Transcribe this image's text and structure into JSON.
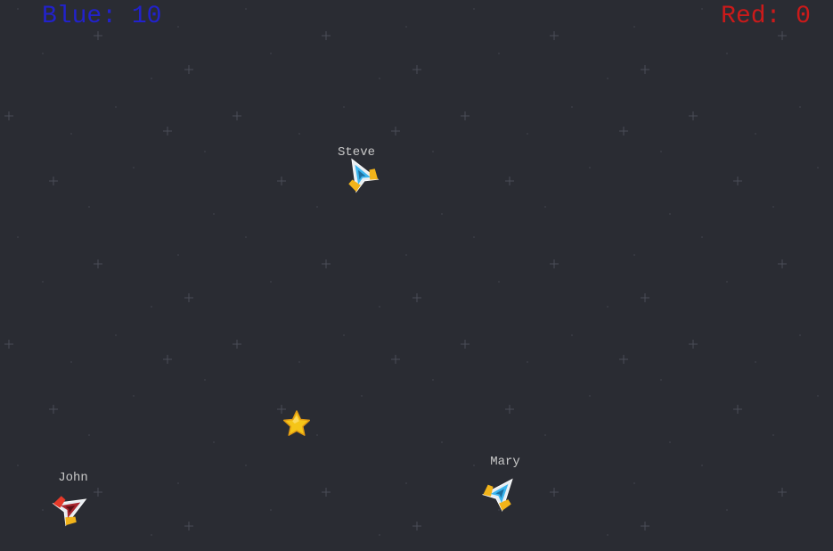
{
  "scoreboard": {
    "blue_label": "Blue: 10",
    "blue_color": "#2222cc",
    "red_label": "Red: 0",
    "red_color": "#cc1a1a"
  },
  "players": {
    "steve": {
      "name": "Steve",
      "team": "blue",
      "icon": "spaceship-icon"
    },
    "mary": {
      "name": "Mary",
      "team": "blue",
      "icon": "spaceship-icon"
    },
    "john": {
      "name": "John",
      "team": "red",
      "icon": "spaceship-icon"
    }
  },
  "pickup": {
    "icon": "star-icon",
    "color": "#f5c518"
  },
  "colors": {
    "background": "#2a2c33",
    "blue_ship_accent": "#3bb5ee",
    "red_ship_accent": "#a8262f",
    "ship_hull": "#e8eef2",
    "ship_trim": "#f2b41a"
  }
}
